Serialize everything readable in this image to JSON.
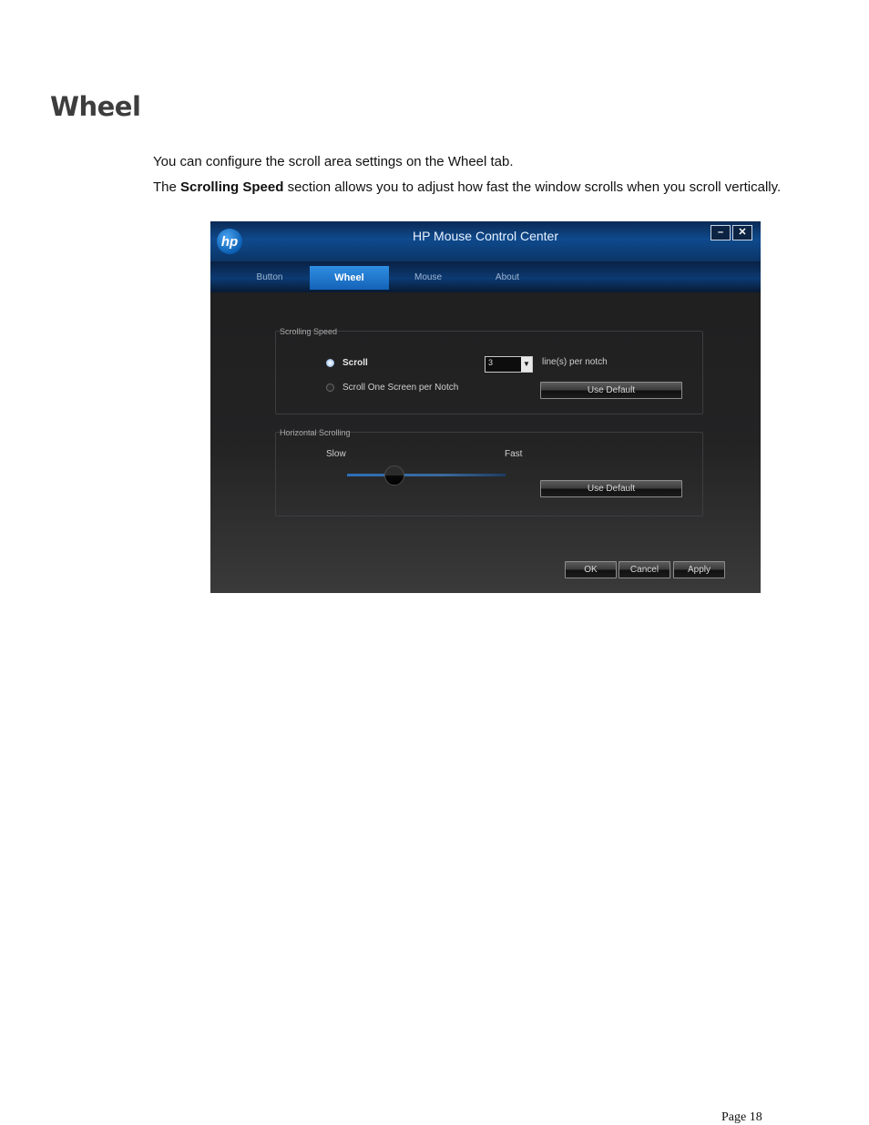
{
  "heading": "Wheel",
  "paragraphs": {
    "p1": "You can configure the scroll area settings on the Wheel tab.",
    "p2_prefix": "The",
    "p2_bold": "Scrolling Speed",
    "p2_suffix": "section allows you to adjust how fast the window scrolls when you scroll vertically."
  },
  "window": {
    "logo": "hp",
    "title": "HP Mouse Control Center",
    "minimize_label": "–",
    "close_label": "✕",
    "tabs": [
      {
        "label": "Button",
        "active": false
      },
      {
        "label": "Wheel",
        "active": true
      },
      {
        "label": "Mouse",
        "active": false
      },
      {
        "label": "About",
        "active": false
      }
    ],
    "scrolling_speed": {
      "title": "Scrolling Speed",
      "option_scroll": "Scroll",
      "option_one_screen": "Scroll One Screen per Notch",
      "selected": "Scroll",
      "lines_value": "3",
      "lines_suffix": "line(s) per notch",
      "use_default": "Use Default"
    },
    "horizontal_scrolling": {
      "title": "Horizontal Scrolling",
      "slow_label": "Slow",
      "fast_label": "Fast",
      "slider_level": 0.3,
      "use_default": "Use Default"
    },
    "footer": {
      "ok": "OK",
      "cancel": "Cancel",
      "apply": "Apply"
    }
  },
  "page_number": "Page 18"
}
